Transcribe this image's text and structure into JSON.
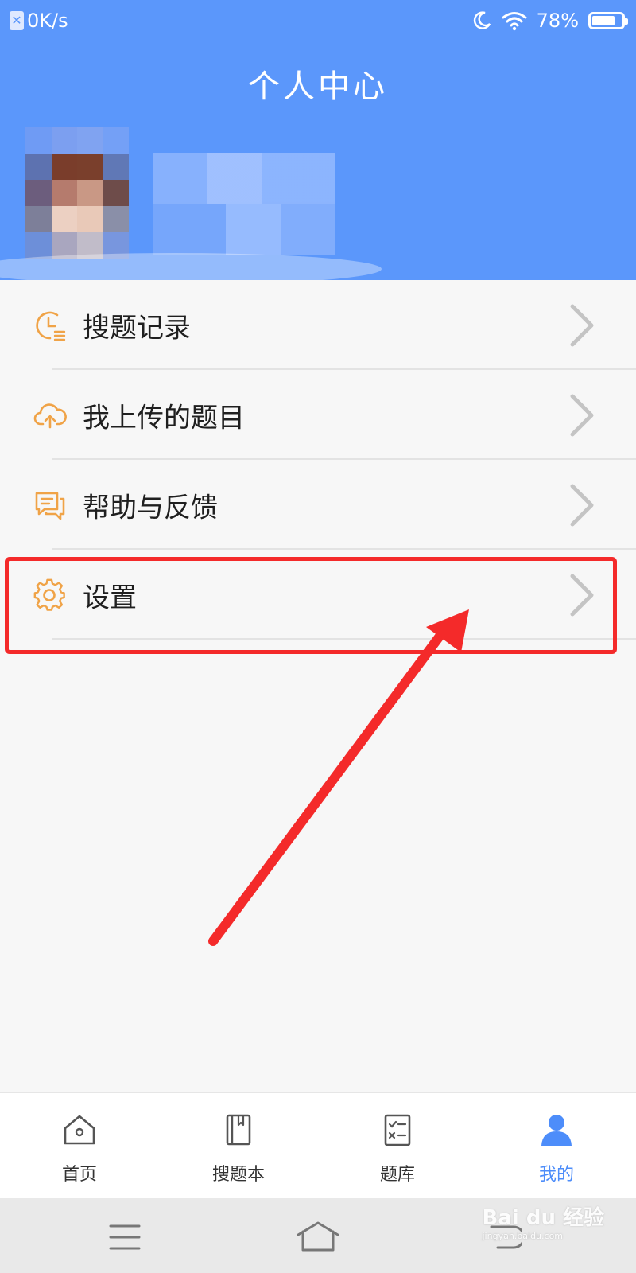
{
  "status_bar": {
    "speed": "0K/s",
    "battery": "78%",
    "battery_level": 0.78
  },
  "header": {
    "title": "个人中心"
  },
  "menu": {
    "items": [
      {
        "label": "搜题记录",
        "icon": "clock-list-icon"
      },
      {
        "label": "我上传的题目",
        "icon": "cloud-upload-icon"
      },
      {
        "label": "帮助与反馈",
        "icon": "chat-bubbles-icon"
      },
      {
        "label": "设置",
        "icon": "gear-icon"
      }
    ]
  },
  "tabbar": {
    "tabs": [
      {
        "label": "首页",
        "icon": "home-icon"
      },
      {
        "label": "搜题本",
        "icon": "notebook-icon"
      },
      {
        "label": "题库",
        "icon": "checklist-icon"
      },
      {
        "label": "我的",
        "icon": "person-icon",
        "active": true
      }
    ]
  },
  "watermark": {
    "brand": "Bai du 经验",
    "url": "jingyan.baidu.com"
  },
  "colors": {
    "header_blue": "#5b97fb",
    "accent_orange": "#f0a347",
    "highlight_red": "#f42a2a",
    "active_tab_blue": "#4d8dfa"
  }
}
